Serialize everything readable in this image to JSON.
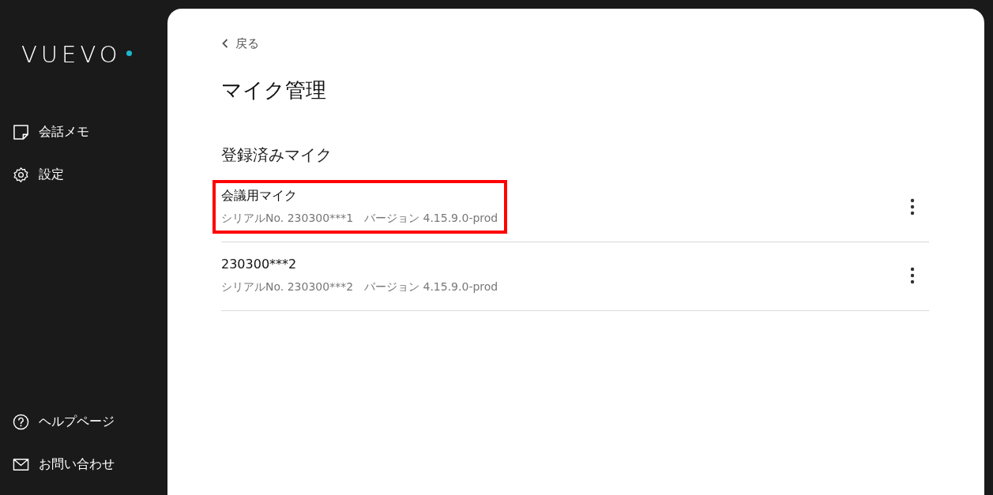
{
  "sidebar": {
    "logo": "VUEVO",
    "top_items": [
      {
        "label": "会話メモ",
        "kind": "note"
      },
      {
        "label": "設定",
        "kind": "gear"
      }
    ],
    "bottom_items": [
      {
        "label": "ヘルプページ",
        "kind": "help"
      },
      {
        "label": "お問い合わせ",
        "kind": "mail"
      }
    ]
  },
  "back_link": "戻る",
  "page_title": "マイク管理",
  "section_title": "登録済みマイク",
  "microphones": [
    {
      "name": "会議用マイク",
      "serial": "シリアルNo. 230300***1",
      "version": "バージョン 4.15.9.0-prod",
      "highlighted": true
    },
    {
      "name": "230300***2",
      "serial": "シリアルNo. 230300***2",
      "version": "バージョン 4.15.9.0-prod",
      "highlighted": false
    }
  ]
}
